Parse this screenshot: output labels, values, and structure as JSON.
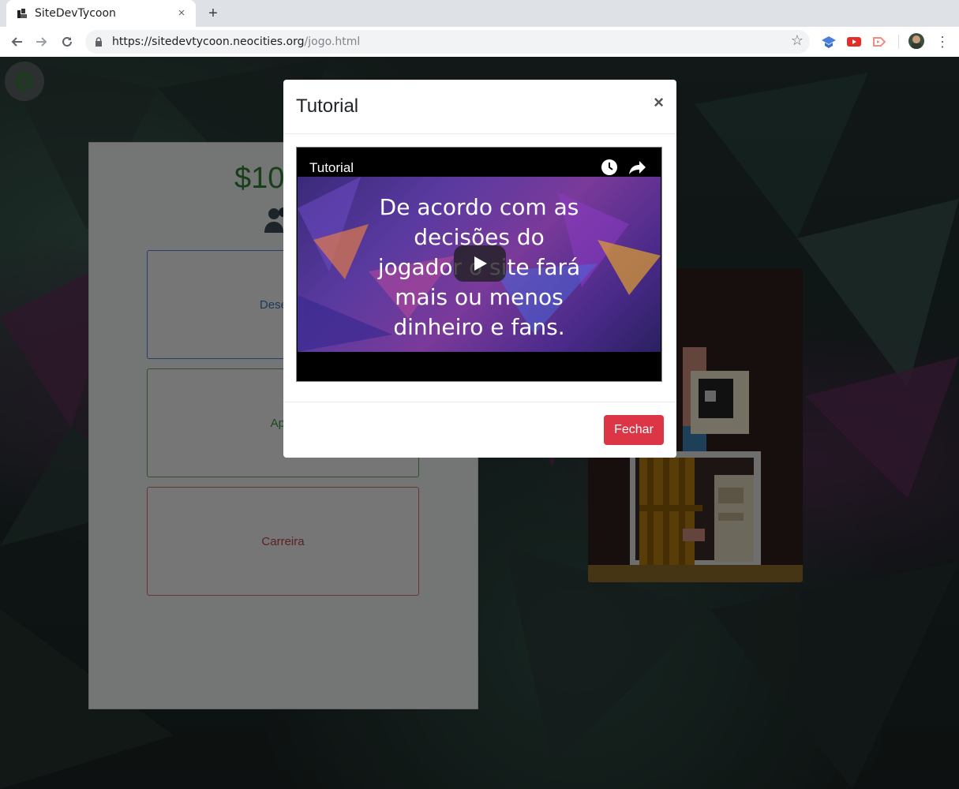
{
  "browser": {
    "tab_title": "SiteDevTycoon",
    "tab_close": "×",
    "new_tab": "+",
    "url_host": "https://sitedevtycoon.neocities.org",
    "url_path": "/jogo.html"
  },
  "game": {
    "money": "$10",
    "options": [
      {
        "label": "Desenvo",
        "color": "#3a6fc0"
      },
      {
        "label": "Apre",
        "color": "#3f8f3f"
      },
      {
        "label": "Carreira",
        "color": "#b84040"
      }
    ]
  },
  "modal": {
    "title": "Tutorial",
    "close": "×",
    "video": {
      "title": "Tutorial",
      "caption_lines": [
        "De acordo com as",
        "decisões do",
        "jogador o site fará",
        "mais ou menos",
        "dinheiro e fans."
      ]
    },
    "button": "Fechar",
    "button_color": "#dc3545"
  }
}
